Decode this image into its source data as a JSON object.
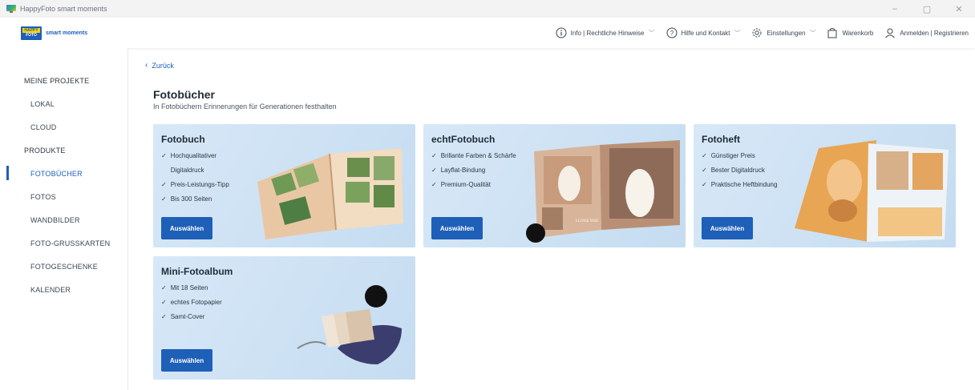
{
  "window": {
    "title": "HappyFoto smart moments",
    "controls": [
      "–",
      "▢",
      "✕"
    ]
  },
  "header": {
    "logo_line1": "HAPPY",
    "logo_line2": "FOTO",
    "logo_text": "smart moments",
    "nav": [
      {
        "label": "Info | Rechtliche Hinweise",
        "icon": "info-icon",
        "dropdown": true
      },
      {
        "label": "Hilfe und Kontakt",
        "icon": "help-icon",
        "dropdown": true
      },
      {
        "label": "Einstellungen",
        "icon": "gear-icon",
        "dropdown": true
      },
      {
        "label": "Warenkorb",
        "icon": "cart-icon",
        "dropdown": false
      },
      {
        "label": "Anmelden | Registrieren",
        "icon": "user-icon",
        "dropdown": false
      }
    ]
  },
  "sidebar": {
    "items": [
      {
        "label": "MEINE PROJEKTE",
        "type": "section"
      },
      {
        "label": "LOKAL",
        "type": "sub"
      },
      {
        "label": "CLOUD",
        "type": "sub"
      },
      {
        "label": "PRODUKTE",
        "type": "section"
      },
      {
        "label": "FOTOBÜCHER",
        "type": "sub",
        "active": true
      },
      {
        "label": "FOTOS",
        "type": "sub"
      },
      {
        "label": "WANDBILDER",
        "type": "sub"
      },
      {
        "label": "FOTO-GRUSSKARTEN",
        "type": "sub"
      },
      {
        "label": "FOTOGESCHENKE",
        "type": "sub"
      },
      {
        "label": "KALENDER",
        "type": "sub"
      }
    ]
  },
  "main": {
    "back_label": "Zurück",
    "title": "Fotobücher",
    "subtitle": "In Fotobüchern Erinnerungen für Generationen festhalten",
    "cards": [
      {
        "title": "Fotobuch",
        "features": [
          "Hochqualitativer Digitaldruck",
          "Preis-Leistungs-Tipp",
          "Bis 300 Seiten"
        ],
        "button": "Auswählen"
      },
      {
        "title": "echtFotobuch",
        "features": [
          "Brillante Farben & Schärfe",
          "Layflat-Bindung",
          "Premium-Qualität"
        ],
        "button": "Auswählen",
        "image_text": "I LOVE YOU"
      },
      {
        "title": "Fotoheft",
        "features": [
          "Günstiger Preis",
          "Bester Digitaldruck",
          "Praktische Heftbindung"
        ],
        "button": "Auswählen"
      },
      {
        "title": "Mini-Fotoalbum",
        "features": [
          "Mit 18 Seiten",
          "echtes Fotopapier",
          "Samt-Cover"
        ],
        "button": "Auswählen"
      }
    ]
  },
  "colors": {
    "accent": "#1e5fb8",
    "card_bg": "#d7e8f7"
  }
}
